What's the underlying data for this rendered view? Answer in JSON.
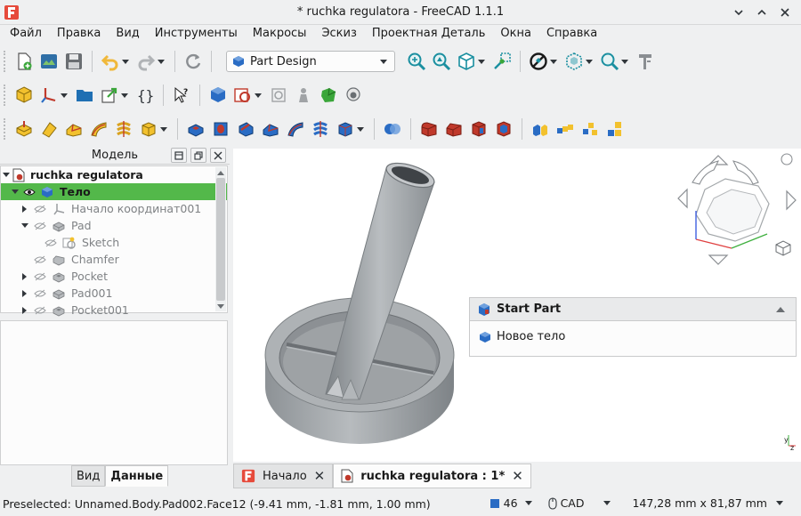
{
  "window": {
    "title": "* ruchka regulatora - FreeCAD 1.1.1"
  },
  "menu": [
    "Файл",
    "Правка",
    "Вид",
    "Инструменты",
    "Макросы",
    "Эскиз",
    "Проектная Деталь",
    "Окна",
    "Справка"
  ],
  "toolbar": {
    "workbench": "Part Design"
  },
  "model_panel": {
    "title": "Модель",
    "tree": [
      {
        "label": "ruchka regulatora",
        "level": 0,
        "expanded": true,
        "icon": "document-icon"
      },
      {
        "label": "Тело",
        "level": 1,
        "expanded": true,
        "icon": "body-icon",
        "active": true
      },
      {
        "label": "Начало координат001",
        "level": 2,
        "expanded": false,
        "icon": "origin-icon"
      },
      {
        "label": "Pad",
        "level": 2,
        "expanded": true,
        "icon": "pad-icon"
      },
      {
        "label": "Sketch",
        "level": 3,
        "icon": "sketch-icon"
      },
      {
        "label": "Chamfer",
        "level": 2,
        "icon": "chamfer-icon"
      },
      {
        "label": "Pocket",
        "level": 2,
        "expanded": false,
        "icon": "pocket-icon"
      },
      {
        "label": "Pad001",
        "level": 2,
        "expanded": false,
        "icon": "pad-icon"
      },
      {
        "label": "Pocket001",
        "level": 2,
        "expanded": false,
        "icon": "pocket-icon"
      }
    ],
    "tabs": [
      "Вид",
      "Данные"
    ],
    "active_tab": "Данные"
  },
  "task_panel": {
    "header": "Start Part",
    "item": "Новое тело"
  },
  "doc_tabs": [
    {
      "label": "Начало",
      "active": false
    },
    {
      "label": "ruchka regulatora : 1*",
      "active": true
    }
  ],
  "status": {
    "preselected": "Preselected: Unnamed.Body.Pad002.Face12 (-9.41 mm, -1.81 mm, 1.00 mm)",
    "zoom_value": "46",
    "nav_style": "CAD",
    "dimensions": "147,28 mm x 81,87 mm"
  },
  "colors": {
    "active_row": "#53b84a",
    "model_gray": "#9ea3a7",
    "accent_blue": "#2a6cc4",
    "partdesign_red": "#c0392b",
    "partdesign_yellow": "#f2c12e"
  }
}
